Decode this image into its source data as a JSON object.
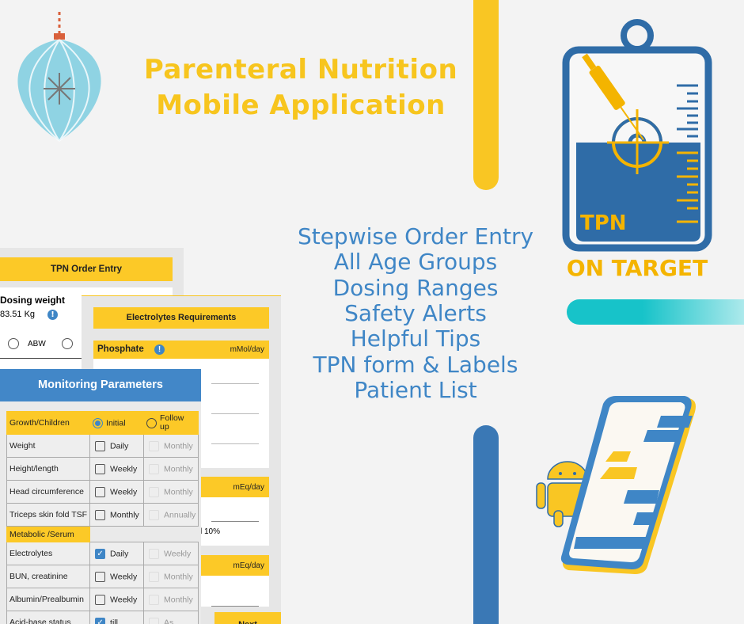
{
  "headline": {
    "line1": "Parenteral Nutrition",
    "line2": "Mobile Application"
  },
  "features": [
    "Stepwise Order Entry",
    "All Age Groups",
    "Dosing Ranges",
    "Safety Alerts",
    "Helpful Tips",
    "TPN form & Labels",
    "Patient List"
  ],
  "logo": {
    "badge": "TPN",
    "tagline": "ON TARGET"
  },
  "colors": {
    "yellow": "#f7c51e",
    "blue": "#3f86c6",
    "teal": "#17c3c9",
    "background": "#f3f3f3"
  },
  "screen_order": {
    "title": "TPN Order Entry",
    "dosing_label": "Dosing weight",
    "dosing_value": "83.51 Kg",
    "radio_abw": "ABW"
  },
  "screen_electrolytes": {
    "title": "Electrolytes Requirements",
    "phosphate": "Phosphate",
    "unit_mmol": "mMol/day",
    "unit_meq1": "mEq/day",
    "unit_meq2": "mEq/day",
    "partial_text": "l 10%",
    "next": "Next"
  },
  "screen_monitoring": {
    "title": "Monitoring Parameters",
    "section1": "Growth/Children",
    "radio_initial": "Initial",
    "radio_follow": "Follow up",
    "rows1": [
      {
        "label": "Weight",
        "opt1": "Daily",
        "opt2": "Monthly",
        "checked": false
      },
      {
        "label": "Height/length",
        "opt1": "Weekly",
        "opt2": "Monthly",
        "checked": false
      },
      {
        "label": "Head circumference",
        "opt1": "Weekly",
        "opt2": "Monthly",
        "checked": false
      },
      {
        "label": "Triceps skin fold TSF",
        "opt1": "Monthly",
        "opt2": "Annually",
        "checked": false
      }
    ],
    "section2": "Metabolic /Serum",
    "rows2": [
      {
        "label": "Electrolytes",
        "opt1": "Daily",
        "opt2": "Weekly",
        "checked": true
      },
      {
        "label": "BUN, creatinine",
        "opt1": "Weekly",
        "opt2": "Monthly",
        "checked": false
      },
      {
        "label": "Albumin/Prealbumin",
        "opt1": "Weekly",
        "opt2": "Monthly",
        "checked": false
      },
      {
        "label": "Acid-base status",
        "opt1": "till",
        "opt2": "As",
        "checked": true
      }
    ]
  }
}
